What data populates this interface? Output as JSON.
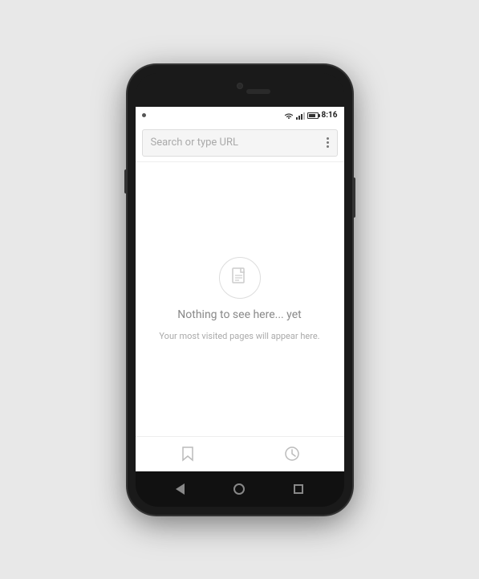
{
  "phone": {
    "status_bar": {
      "time": "8:16",
      "notification_dot": true
    },
    "url_bar": {
      "placeholder": "Search or type URL"
    },
    "main_content": {
      "empty_title": "Nothing to see here... yet",
      "empty_subtitle": "Your most visited pages will appear here."
    },
    "bottom_toolbar": {
      "bookmark_icon": "☆",
      "history_icon": "🕐"
    },
    "nav_bar": {
      "back_label": "back",
      "home_label": "home",
      "recents_label": "recents"
    }
  }
}
